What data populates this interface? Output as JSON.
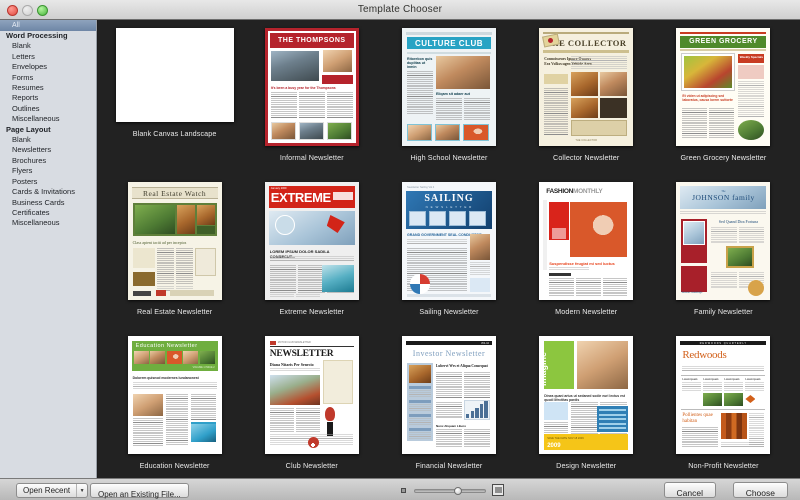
{
  "window": {
    "title": "Template Chooser",
    "controls": [
      "close",
      "minimize",
      "zoom"
    ]
  },
  "sidebar": {
    "all_label": "All",
    "sections": [
      {
        "label": "Word Processing",
        "items": [
          "Blank",
          "Letters",
          "Envelopes",
          "Forms",
          "Resumes",
          "Reports",
          "Outlines",
          "Miscellaneous"
        ]
      },
      {
        "label": "Page Layout",
        "items": [
          "Blank",
          "Newsletters",
          "Brochures",
          "Flyers",
          "Posters",
          "Cards & Invitations",
          "Business Cards",
          "Certificates",
          "Miscellaneous"
        ]
      }
    ]
  },
  "templates": [
    {
      "id": "blank-canvas-landscape",
      "label": "Blank Canvas Landscape",
      "style": "blank",
      "orientation": "landscape"
    },
    {
      "id": "informal-newsletter",
      "label": "Informal Newsletter",
      "style": "thompsons",
      "masthead": "THE THOMPSONS",
      "headline": "It's been a busy year for the Thompsons",
      "accent": "#b5232c"
    },
    {
      "id": "high-school-newsletter",
      "label": "High School Newsletter",
      "style": "culture",
      "masthead": "CULTURE CLUB",
      "headline": "Ritorebon quis duplitas ut inmin",
      "subhead": "Eliqam sit adaer aut",
      "accent": "#27a3c4"
    },
    {
      "id": "collector-newsletter",
      "label": "Collector Newsletter",
      "style": "collector",
      "masthead": "THE COLLECTOR",
      "headline": "Connoisseurs Ignore Owners Era Volkswagen Vehicle Area",
      "accent": "#8a7540"
    },
    {
      "id": "green-grocery-newsletter",
      "label": "Green Grocery Newsletter",
      "style": "grocery",
      "masthead": "GREEN GROCERY",
      "headline": "Et viden ut adipiscing sed laboratus, causa lorem suttorte",
      "badge": "Weekly Specials",
      "accent": "#4f8a2b"
    },
    {
      "id": "real-estate-newsletter",
      "label": "Real Estate Newsletter",
      "style": "realestate",
      "masthead": "Real Estate Watch",
      "headline": "Class aptent taciti ad per inceptos",
      "accent": "#5f7f3a"
    },
    {
      "id": "extreme-newsletter",
      "label": "Extreme Newsletter",
      "style": "extreme",
      "masthead": "EXTREME",
      "headline": "LOREM IPSUM DOLOR SADILA CONSECUT...",
      "accent": "#d22418"
    },
    {
      "id": "sailing-newsletter",
      "label": "Sailing Newsletter",
      "style": "sailing",
      "masthead": "SAILING",
      "submast": "N E W S L E T T E R",
      "headline": "GRAND GOVERNMENT SEAL CONDUCTOR",
      "accent": "#1d5f96"
    },
    {
      "id": "modern-newsletter",
      "label": "Modern Newsletter",
      "style": "fashion",
      "masthead": "FASHIONMONTHLY",
      "headline": "Suspendisse feugiat mi sed luctus",
      "accent": "#e8431b"
    },
    {
      "id": "family-newsletter",
      "label": "Family Newsletter",
      "style": "johnson",
      "masthead": "JOHNSON family",
      "mast_prefix": "The",
      "headline": "Sed Quand Dira Fortuna",
      "accent": "#3b6d9c"
    },
    {
      "id": "education-newsletter",
      "label": "Education Newsletter",
      "style": "education",
      "masthead": "Education Newsletter",
      "accent": "#6fae3f"
    },
    {
      "id": "club-newsletter",
      "label": "Club Newsletter",
      "style": "club",
      "masthead": "NEWSLETTER",
      "headline": "Diana Nitaris Per Senecio",
      "accent": "#c0392b"
    },
    {
      "id": "financial-newsletter",
      "label": "Financial Newsletter",
      "style": "financial",
      "masthead": "Investor Newsletter",
      "headline": "Lubervi Wrs et Aliqua Consequat",
      "accent": "#7d9dbd"
    },
    {
      "id": "design-newsletter",
      "label": "Design Newsletter",
      "style": "design",
      "masthead": "imagine",
      "year": "2009",
      "headline": "Dinea quani artus ut sedaned sodie euri lectus est quodi lifectitas pardis",
      "accent": "#8cc63f"
    },
    {
      "id": "non-profit-newsletter",
      "label": "Non-Profit Newsletter",
      "style": "redwoods",
      "masthead": "Redwoods",
      "headline": "Pollientes quae habitan",
      "accent": "#d2601a"
    }
  ],
  "toolbar": {
    "open_recent_label": "Open Recent",
    "open_existing_label": "Open an Existing File...",
    "cancel_label": "Cancel",
    "choose_label": "Choose",
    "slider_value": 62,
    "small_icon": "small-thumbnail-icon",
    "large_icon": "large-thumbnail-icon"
  }
}
